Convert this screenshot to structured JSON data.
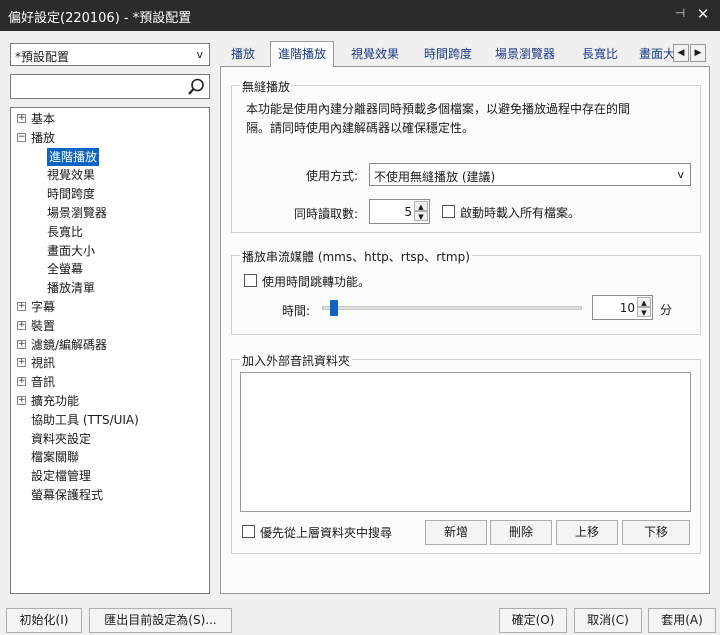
{
  "window": {
    "title": "偏好設定(220106) - *預設配置",
    "pin_glyph": "⊣",
    "close_glyph": "✕"
  },
  "preset": {
    "value": "*預設配置",
    "arrow": "v"
  },
  "tree": [
    {
      "label": "基本",
      "toggle": "+",
      "level": 0
    },
    {
      "label": "播放",
      "toggle": "−",
      "level": 0
    },
    {
      "label": "進階播放",
      "level": 1,
      "selected": true
    },
    {
      "label": "視覺效果",
      "level": 1
    },
    {
      "label": "時間跨度",
      "level": 1
    },
    {
      "label": "場景瀏覽器",
      "level": 1
    },
    {
      "label": "長寬比",
      "level": 1
    },
    {
      "label": "畫面大小",
      "level": 1
    },
    {
      "label": "全螢幕",
      "level": 1
    },
    {
      "label": "播放清單",
      "level": 1
    },
    {
      "label": "字幕",
      "toggle": "+",
      "level": 0
    },
    {
      "label": "裝置",
      "toggle": "+",
      "level": 0
    },
    {
      "label": "濾鏡/編解碼器",
      "toggle": "+",
      "level": 0
    },
    {
      "label": "視訊",
      "toggle": "+",
      "level": 0
    },
    {
      "label": "音訊",
      "toggle": "+",
      "level": 0
    },
    {
      "label": "擴充功能",
      "toggle": "+",
      "level": 0
    },
    {
      "label": "協助工具 (TTS/UIA)",
      "level": 0
    },
    {
      "label": "資料夾設定",
      "level": 0
    },
    {
      "label": "檔案關聯",
      "level": 0
    },
    {
      "label": "設定檔管理",
      "level": 0
    },
    {
      "label": "螢幕保護程式",
      "level": 0
    }
  ],
  "tabs": [
    "播放",
    "進階播放",
    "視覺效果",
    "時間跨度",
    "場景瀏覽器",
    "長寬比",
    "畫面大"
  ],
  "tab_scroll": {
    "left": "◀",
    "right": "▶"
  },
  "seamless": {
    "title": "無縫播放",
    "desc1": "本功能是使用內建分離器同時預載多個檔案，以避免播放過程中存在的間",
    "desc2": "隔。請同時使用內建解碼器以確保穩定性。",
    "mode_label": "使用方式:",
    "mode_value": "不使用無縫播放 (建議)",
    "mode_arrow": "v",
    "concurrent_label": "同時讀取數:",
    "concurrent_value": "5",
    "load_all_label": "啟動時載入所有檔案。"
  },
  "stream": {
    "title": "播放串流媒體 (mms、http、rtsp、rtmp)",
    "jump_label": "使用時間跳轉功能。",
    "time_label": "時間:",
    "time_value": "10",
    "unit": "分",
    "slider_fraction": 0.03
  },
  "audio_folder": {
    "title": "加入外部音訊資料夾",
    "parent_search_label": "優先從上層資料夾中搜尋",
    "add": "新增",
    "remove": "刪除",
    "up": "上移",
    "down": "下移"
  },
  "footer": {
    "init": "初始化(I)",
    "export": "匯出目前設定為(S)...",
    "ok": "確定(O)",
    "cancel": "取消(C)",
    "apply": "套用(A)"
  },
  "spin_up": "▲",
  "spin_down": "▼"
}
